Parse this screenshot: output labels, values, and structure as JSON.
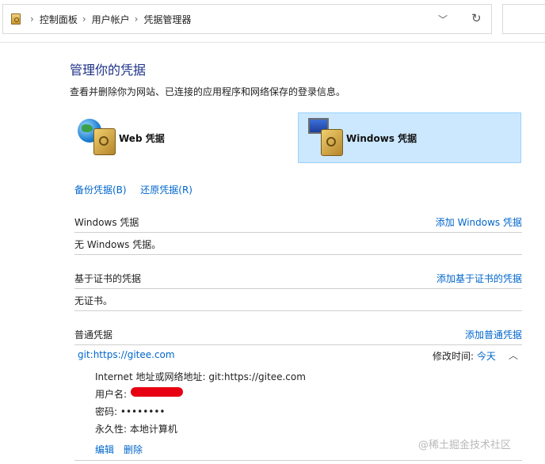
{
  "address_bar": {
    "crumbs": [
      "控制面板",
      "用户帐户",
      "凭据管理器"
    ],
    "dropdown_glyph": "﹀",
    "refresh_glyph": "↻"
  },
  "page": {
    "title": "管理你的凭据",
    "description": "查看并删除你为网站、已连接的应用程序和网络保存的登录信息。"
  },
  "credential_types": {
    "web": "Web 凭据",
    "windows": "Windows 凭据"
  },
  "actions": {
    "backup": "备份凭据(B)",
    "restore": "还原凭据(R)"
  },
  "sections": {
    "windows": {
      "header": "Windows 凭据",
      "add": "添加 Windows 凭据",
      "empty": "无 Windows 凭据。"
    },
    "certificate": {
      "header": "基于证书的凭据",
      "add": "添加基于证书的凭据",
      "empty": "无证书。"
    },
    "generic": {
      "header": "普通凭据",
      "add": "添加普通凭据"
    }
  },
  "entry": {
    "name": "git:https://gitee.com",
    "modified_label": "修改时间:",
    "modified_value": "今天",
    "expand_glyph": "︿",
    "address_label": "Internet 地址或网络地址:",
    "address_value": "git:https://gitee.com",
    "username_label": "用户名:",
    "password_label": "密码:",
    "password_value": "••••••••",
    "persistence_label": "永久性:",
    "persistence_value": "本地计算机",
    "edit": "编辑",
    "delete": "删除"
  },
  "watermark": "@稀土掘金技术社区",
  "colors": {
    "link": "#0066cc",
    "title": "#1e3287",
    "selected_bg": "#cce8ff",
    "redaction": "#e60012"
  },
  "icons": [
    "control-panel-icon",
    "globe-icon",
    "safe-icon",
    "monitor-icon",
    "chevron-right-icon",
    "refresh-icon"
  ]
}
